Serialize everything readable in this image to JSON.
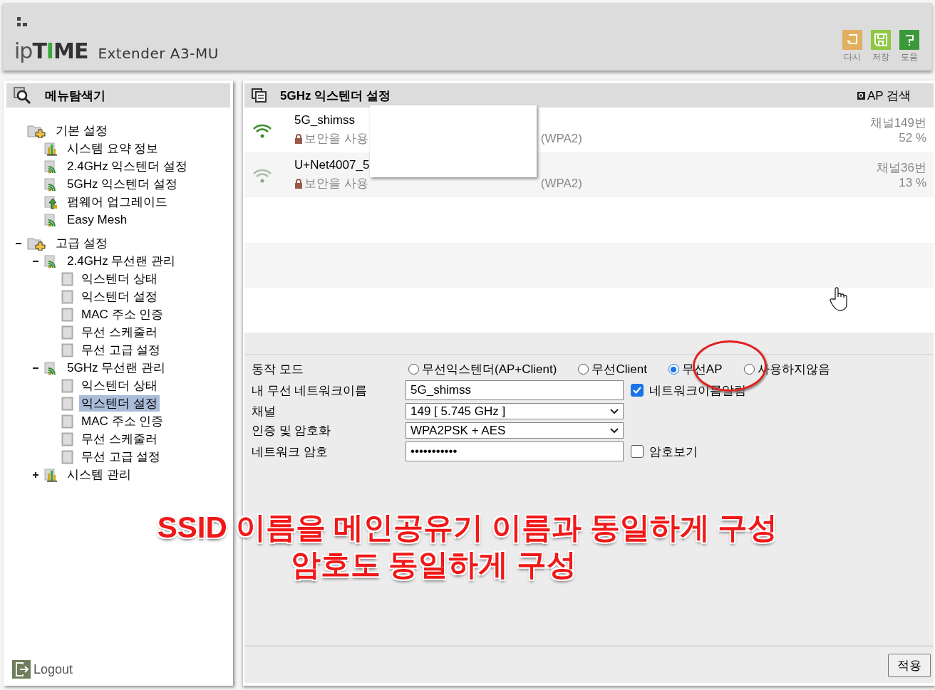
{
  "header": {
    "logo": "ipTIME",
    "model": "Extender A3-MU",
    "tools": [
      {
        "kind": "undo",
        "label": "다시"
      },
      {
        "kind": "save",
        "label": "저장"
      },
      {
        "kind": "help",
        "label": "도움"
      }
    ]
  },
  "sidebar": {
    "title": "메뉴탐색기",
    "tree": [
      {
        "label": "기본 설정",
        "kind": "group",
        "selected": false,
        "children": [
          {
            "label": "시스템 요약 정보",
            "kind": "chart",
            "selected": false
          },
          {
            "label": "2.4GHz 익스텐더 설정",
            "kind": "wireless",
            "selected": false
          },
          {
            "label": "5GHz 익스텐더 설정",
            "kind": "wireless",
            "selected": false
          },
          {
            "label": "펌웨어 업그레이드",
            "kind": "upgrade",
            "selected": false
          },
          {
            "label": "Easy Mesh",
            "kind": "wireless",
            "selected": false
          }
        ]
      },
      {
        "label": "고급 설정",
        "kind": "group",
        "selected": false,
        "expanded": true,
        "children": [
          {
            "label": "2.4GHz 무선랜 관리",
            "kind": "wireless",
            "selected": false,
            "expanded": true,
            "children": [
              {
                "label": "익스텐더 상태",
                "kind": "page",
                "selected": false
              },
              {
                "label": "익스텐더 설정",
                "kind": "page",
                "selected": false
              },
              {
                "label": "MAC 주소 인증",
                "kind": "page",
                "selected": false
              },
              {
                "label": "무선 스케줄러",
                "kind": "page",
                "selected": false
              },
              {
                "label": "무선 고급 설정",
                "kind": "page",
                "selected": false
              }
            ]
          },
          {
            "label": "5GHz 무선랜 관리",
            "kind": "wireless",
            "selected": false,
            "expanded": true,
            "children": [
              {
                "label": "익스텐더 상태",
                "kind": "page",
                "selected": false
              },
              {
                "label": "익스텐더 설정",
                "kind": "page",
                "selected": true
              },
              {
                "label": "MAC 주소 인증",
                "kind": "page",
                "selected": false
              },
              {
                "label": "무선 스케줄러",
                "kind": "page",
                "selected": false
              },
              {
                "label": "무선 고급 설정",
                "kind": "page",
                "selected": false
              }
            ]
          },
          {
            "label": "시스템 관리",
            "kind": "chart",
            "selected": false,
            "expanded": false
          }
        ]
      }
    ],
    "logout": "Logout"
  },
  "main": {
    "title": "5GHz 익스텐더 설정",
    "ap_search": "AP 검색",
    "networks": [
      {
        "name": "5G_shimss",
        "security": [
          "보안을 사용",
          "(WPA2)"
        ],
        "channel": "채널149번",
        "signal": "52 %",
        "strong": true
      },
      {
        "name": "U+Net4007_5",
        "security": [
          "보안을 사용",
          "(WPA2)"
        ],
        "channel": "채널36번",
        "signal": "13 %",
        "strong": false
      }
    ],
    "form": {
      "mode_label": "동작 모드",
      "modes": [
        {
          "label": "무선익스텐더(AP+Client)",
          "selected": false
        },
        {
          "label": "무선Client",
          "selected": false
        },
        {
          "label": "무선AP",
          "selected": true
        },
        {
          "label": "사용하지않음",
          "selected": false
        }
      ],
      "ssid_label": "내 무선 네트워크이름",
      "ssid": "5G_shimss",
      "broadcast_label": "네트워크이름알림",
      "broadcast": {
        "checked": true
      },
      "channel_label": "채널",
      "channel": "149 [ 5.745 GHz ]",
      "auth_label": "인증 및 암호화",
      "auth": "WPA2PSK + AES",
      "key_label": "네트워크 암호",
      "key": "•••••••••••",
      "show_label": "암호보기",
      "show": {
        "checked": false
      }
    },
    "apply": "적용"
  },
  "annotation": [
    "SSID 이름을 메인공유기 이름과 동일하게 구성",
    "암호도 동일하게 구성"
  ]
}
